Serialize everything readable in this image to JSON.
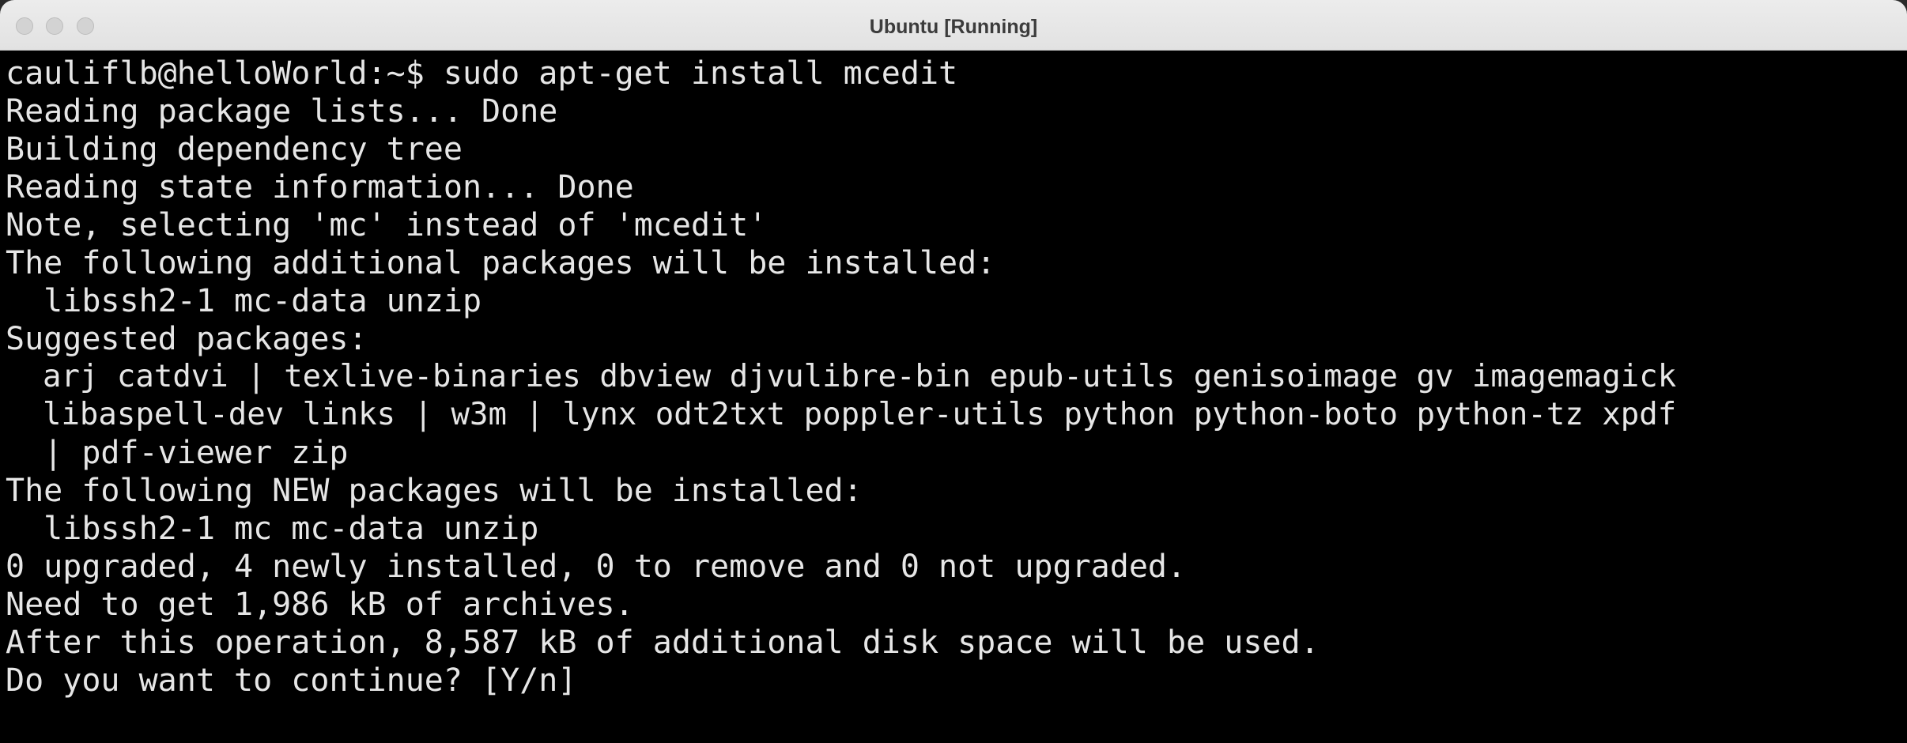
{
  "window": {
    "title": "Ubuntu [Running]"
  },
  "terminal": {
    "lines": [
      "cauliflb@helloWorld:~$ sudo apt-get install mcedit",
      "Reading package lists... Done",
      "Building dependency tree",
      "Reading state information... Done",
      "Note, selecting 'mc' instead of 'mcedit'",
      "The following additional packages will be installed:",
      "  libssh2-1 mc-data unzip",
      "Suggested packages:",
      "  arj catdvi | texlive-binaries dbview djvulibre-bin epub-utils genisoimage gv imagemagick",
      "  libaspell-dev links | w3m | lynx odt2txt poppler-utils python python-boto python-tz xpdf",
      "  | pdf-viewer zip",
      "The following NEW packages will be installed:",
      "  libssh2-1 mc mc-data unzip",
      "0 upgraded, 4 newly installed, 0 to remove and 0 not upgraded.",
      "Need to get 1,986 kB of archives.",
      "After this operation, 8,587 kB of additional disk space will be used.",
      "Do you want to continue? [Y/n]"
    ]
  }
}
